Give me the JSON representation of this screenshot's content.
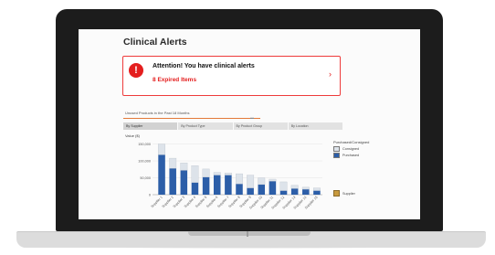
{
  "alerts": {
    "title": "Clinical Alerts",
    "icon": "exclamation-icon",
    "icon_glyph": "!",
    "heading": "Attention! You have clinical alerts",
    "count": "8",
    "count_label": "Expired Items",
    "chevron": "›",
    "accent_color": "#e41e1e"
  },
  "panel": {
    "title": "Unused Products in the Past 18 Months",
    "rule_mark": "▬",
    "tabs": [
      "By Supplier",
      "By Product Type",
      "By Product Group",
      "By Location"
    ],
    "active_tab": "By Supplier",
    "y_title": "Value ($)"
  },
  "legend": {
    "title": "Purchased/Consigned",
    "items": [
      {
        "label": "Consigned",
        "color": "#dde3ea"
      },
      {
        "label": "Purchased",
        "color": "#2c5ea8"
      }
    ],
    "group_label": "Supplier"
  },
  "chart_data": {
    "type": "bar",
    "stacked": true,
    "categories": [
      "Supplier 1",
      "Supplier 2",
      "Supplier 3",
      "Supplier 4",
      "Supplier 5",
      "Supplier 6",
      "Supplier 7",
      "Supplier 8",
      "Supplier 9",
      "Supplier 10",
      "Supplier 11",
      "Supplier 12",
      "Supplier 13",
      "Supplier 14",
      "Supplier 15"
    ],
    "series": [
      {
        "name": "Purchased",
        "values": [
          118000,
          78000,
          72000,
          36000,
          52000,
          58000,
          58000,
          32000,
          20000,
          30000,
          40000,
          12000,
          18000,
          16000,
          12000
        ]
      },
      {
        "name": "Consigned",
        "values": [
          32000,
          30000,
          22000,
          50000,
          24000,
          8000,
          6000,
          30000,
          38000,
          20000,
          6000,
          26000,
          10000,
          6000,
          8000
        ]
      }
    ],
    "colors": {
      "Purchased": "#2c5ea8",
      "Consigned": "#dde3ea"
    },
    "yticks": [
      "150,000",
      "100,000",
      "50,000",
      "0"
    ],
    "ytick_values": [
      150000,
      100000,
      50000,
      0
    ],
    "ylim": [
      0,
      165000
    ],
    "ylabel": "Value ($)",
    "grid": true,
    "legend_position": "right"
  }
}
